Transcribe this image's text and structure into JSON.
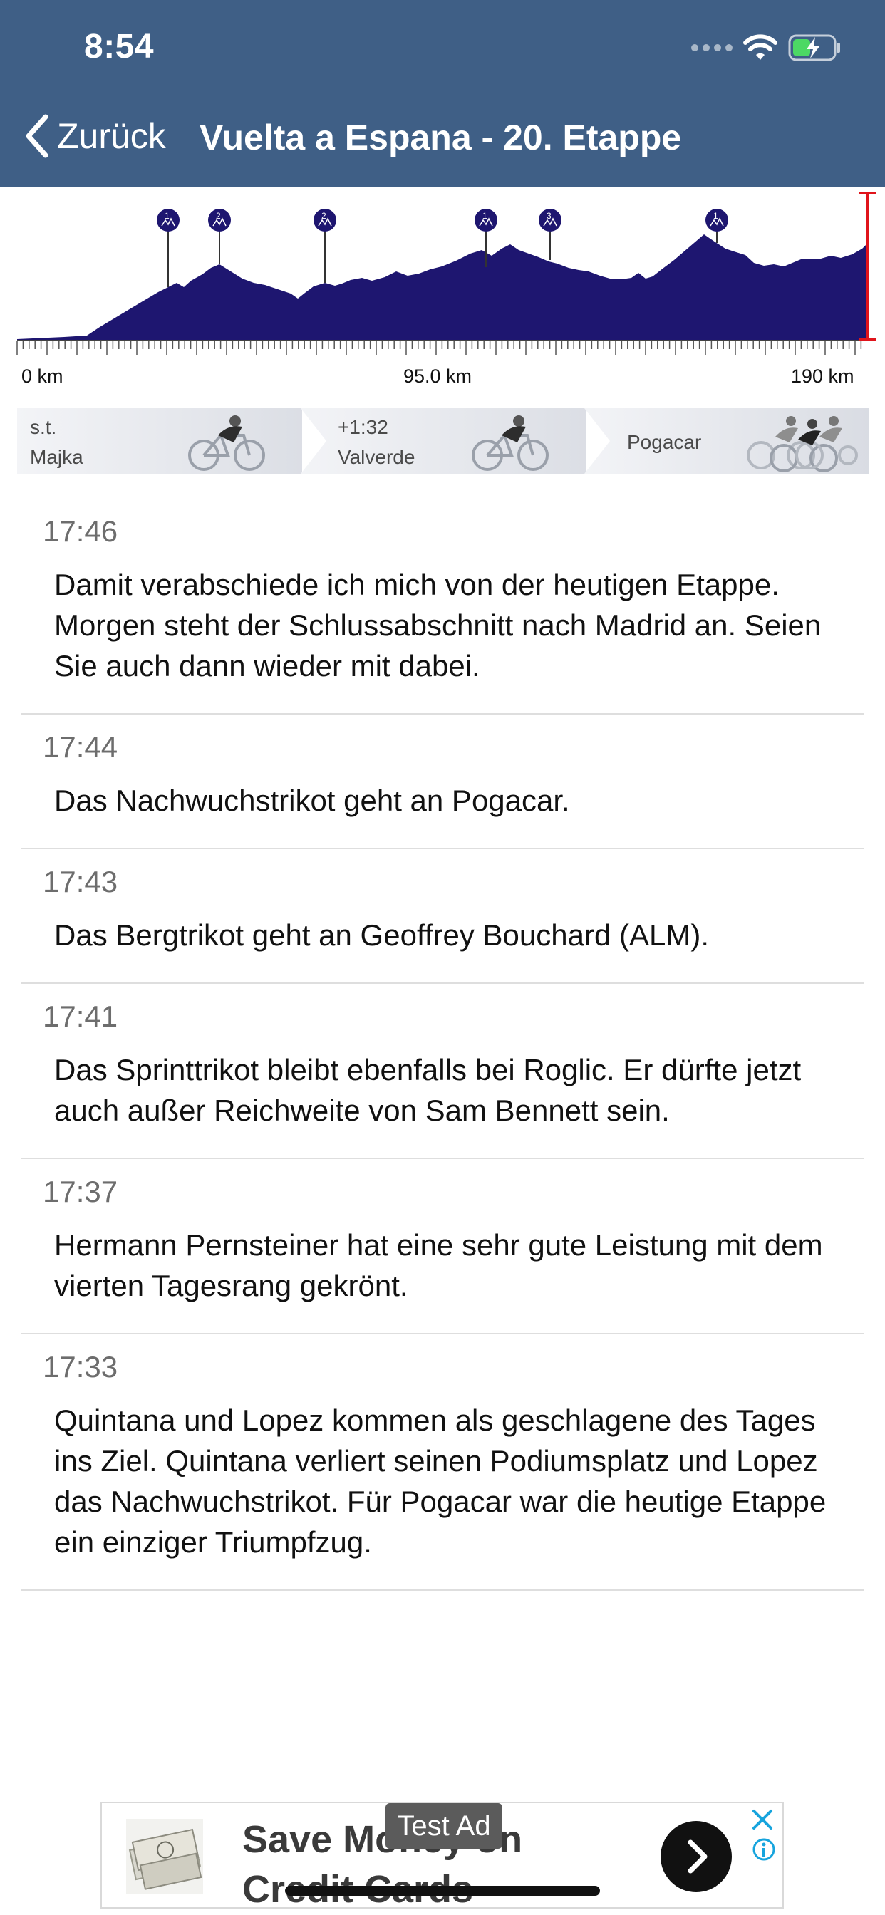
{
  "status_bar": {
    "time": "8:54"
  },
  "nav": {
    "back_label": "Zurück",
    "title": "Vuelta a Espana - 20. Etappe"
  },
  "profile": {
    "start_label": "0 km",
    "mid_label": "95.0 km",
    "end_label": "190 km",
    "fill_color": "#1e1670",
    "marker_color": "#e0141b",
    "climb_badges": [
      "1",
      "2",
      "2",
      "1",
      "3",
      "1"
    ]
  },
  "standings": [
    {
      "gap": "s.t.",
      "name": "Majka"
    },
    {
      "gap": "+1:32",
      "name": "Valverde"
    },
    {
      "gap": "",
      "name": "Pogacar"
    }
  ],
  "feed": [
    {
      "time": "17:46",
      "text": "Damit verabschiede ich mich von der heutigen Etappe. Morgen steht der Schlussabschnitt nach Madrid an. Seien Sie auch dann wieder mit dabei."
    },
    {
      "time": "17:44",
      "text": "Das Nachwuchstrikot geht an Pogacar."
    },
    {
      "time": "17:43",
      "text": "Das Bergtrikot geht an Geoffrey Bouchard (ALM)."
    },
    {
      "time": "17:41",
      "text": "Das Sprinttrikot bleibt ebenfalls bei Roglic. Er dürfte jetzt auch außer Reichweite von Sam Bennett sein."
    },
    {
      "time": "17:37",
      "text": "Hermann Pernsteiner hat eine sehr gute Leistung mit dem vierten Tagesrang gekrönt."
    },
    {
      "time": "17:33",
      "text": "Quintana und Lopez kommen als geschlagene des Tages ins Ziel. Quintana verliert seinen Podiumsplatz und Lopez das Nachwuchstrikot. Für Pogacar war die heutige Etappe ein einziger Triumpfzug."
    }
  ],
  "ad": {
    "title_line1": "Save Money on",
    "title_line2": "Credit Cards",
    "tag": "Test Ad"
  }
}
